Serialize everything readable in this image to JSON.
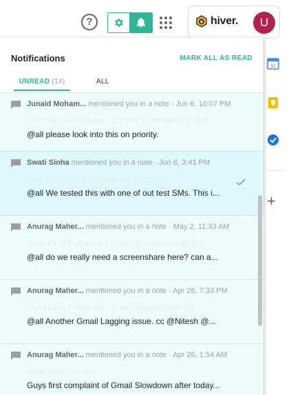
{
  "topbar": {
    "help_glyph": "?",
    "hiver_brand": "hiver.",
    "avatar_initial": "U",
    "colors": {
      "accent": "#2fb59a",
      "avatar": "#b3214f"
    }
  },
  "panel": {
    "title": "Notifications",
    "mark_all": "MARK ALL AS READ",
    "tabs": {
      "unread": "UNREAD",
      "unread_count": "(14)",
      "all": "ALL"
    }
  },
  "notifications": [
    {
      "sender": "Junaid Moham...",
      "action": "mentioned you in a note",
      "time": "Jun 6, 10:07 PM",
      "subject": "Hiver Chat Follow-up | Chrome Extension Review",
      "body": "@all please look into this on priority."
    },
    {
      "sender": "Swati Sinha",
      "action": "mentioned you in a note",
      "time": "Jun 6, 3:41 PM",
      "subject": "Experience testing feedback from SMs",
      "body": "@all We tested this with one of out test SMs. This i..."
    },
    {
      "sender": "Anurag Maher...",
      "action": "mentioned you in a note",
      "time": "May 2, 11:33 AM",
      "subject": "Hiver Chat Follow-up | Gmail Slowdown with Ext",
      "body": "@all do we really need a screenshare here? can a..."
    },
    {
      "sender": "Anurag Maher...",
      "action": "mentioned you in a note",
      "time": "Apr 26, 7:33 PM",
      "subject": "Hiver Chat Follow-up | Gmail Lagging with CS",
      "body": "@all Another Gmail Lagging issue. cc @Nitesh @..."
    },
    {
      "sender": "Anurag Maher...",
      "action": "mentioned you in a note",
      "time": "Apr 26, 1:54 AM",
      "subject": "Issue with Chrome",
      "body": "Guys first complaint of Gmail Slowdown after today..."
    }
  ],
  "icons": {
    "help": "help-circle-icon",
    "settings": "gear-icon",
    "notifications": "bell-icon",
    "apps": "apps-grid-icon",
    "note": "comment-icon",
    "read": "check-icon",
    "calendar": "calendar-icon",
    "keep": "bulb-icon",
    "tasks": "tasks-icon",
    "add": "plus-icon"
  },
  "rail": {
    "calendar_day": "31",
    "add_glyph": "+"
  }
}
